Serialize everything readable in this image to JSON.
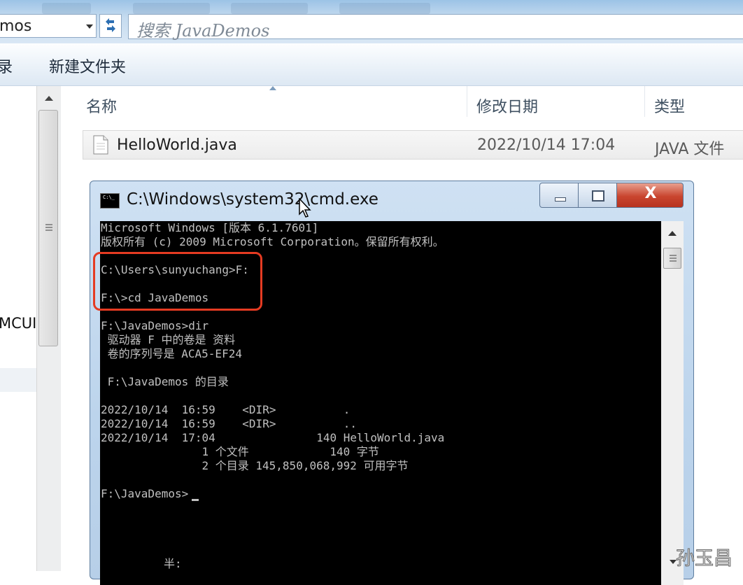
{
  "explorer": {
    "address_fragment": "mos",
    "search_placeholder": "搜索 JavaDemos",
    "toolbar": {
      "left_fragment": "录",
      "new_folder_label": "新建文件夹"
    },
    "nav": {
      "partial_label": "MCUI"
    },
    "columns": {
      "name": "名称",
      "modified": "修改日期",
      "type": "类型"
    },
    "files": [
      {
        "name": "HelloWorld.java",
        "modified": "2022/10/14 17:04",
        "type": "JAVA 文件"
      }
    ]
  },
  "cmd": {
    "title": "C:\\Windows\\system32\\cmd.exe",
    "icon_text": "C:\\_",
    "close_glyph": "X",
    "lines": [
      "Microsoft Windows [版本 6.1.7601]",
      "版权所有 (c) 2009 Microsoft Corporation。保留所有权利。",
      "",
      "C:\\Users\\sunyuchang>F:",
      "",
      "F:\\>cd JavaDemos",
      "",
      "F:\\JavaDemos>dir",
      " 驱动器 F 中的卷是 资料",
      " 卷的序列号是 ACA5-EF24",
      "",
      " F:\\JavaDemos 的目录",
      "",
      "2022/10/14  16:59    <DIR>          .",
      "2022/10/14  16:59    <DIR>          ..",
      "2022/10/14  17:04               140 HelloWorld.java",
      "               1 个文件            140 字节",
      "               2 个目录 145,850,068,992 可用字节",
      "",
      "F:\\JavaDemos>"
    ],
    "ime_status": "半:"
  },
  "watermark": "孙玉昌",
  "colors": {
    "highlight": "#e53b22",
    "console_bg": "#000000",
    "console_fg": "#c0c0c0"
  }
}
